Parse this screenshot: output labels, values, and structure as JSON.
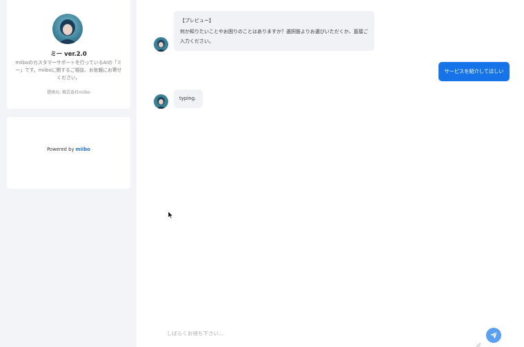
{
  "sidebar": {
    "bot_name": "ミー ver.2.0",
    "description": "miiboのカスタマーサポートを行っているAIの「ミー」です。miiboに関するご相談、お気軽にお寄せください。",
    "provider": "提供元: 株式会社miibo",
    "powered_prefix": "Powered by ",
    "powered_brand": "miibo"
  },
  "chat": {
    "messages": [
      {
        "role": "bot",
        "title": "【プレビュー】",
        "text": "何か知りたいことやお困りのことはありますか？選択肢よりお選びいただくか、直接ご入力ください。"
      },
      {
        "role": "user",
        "text": "サービスを紹介してほしい"
      },
      {
        "role": "bot",
        "text": "typing."
      }
    ],
    "input_placeholder": "しばらくお待ち下さい..."
  },
  "colors": {
    "accent": "#1673e8",
    "send_button": "#5aa0f0",
    "sidebar_bg": "#f3f4f7",
    "bot_bubble": "#f1f2f6"
  },
  "icons": [
    "avatar-image",
    "send-icon",
    "resize-handle-icon",
    "mouse-pointer-icon"
  ]
}
